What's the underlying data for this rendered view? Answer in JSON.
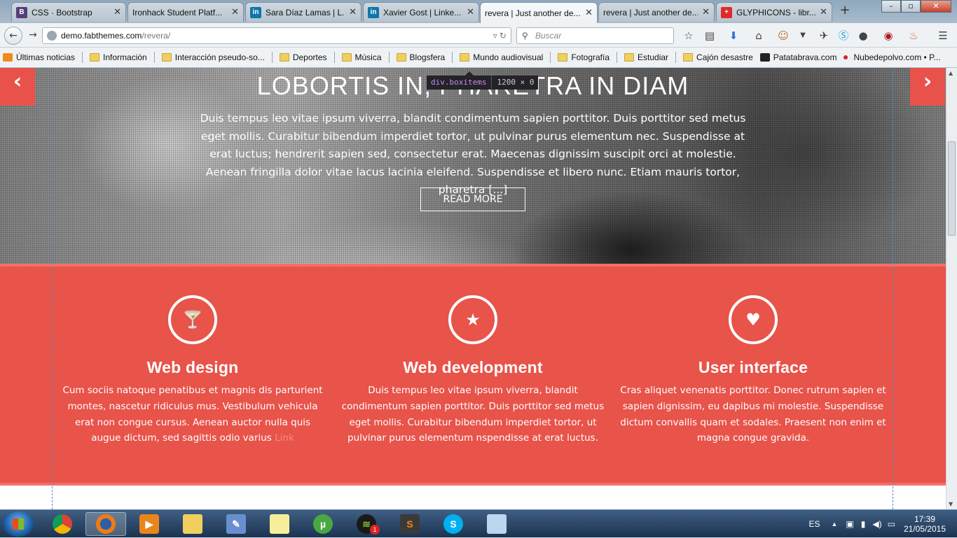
{
  "browser": {
    "tabs": [
      {
        "title": "CSS · Bootstrap",
        "favicon": "B",
        "favicon_color": "#563d7c"
      },
      {
        "title": "Ironhack Student Platf...",
        "favicon": "",
        "favicon_color": ""
      },
      {
        "title": "Sara Díaz Lamas | L...",
        "favicon": "in",
        "favicon_color": "#0e76a8"
      },
      {
        "title": "Xavier Gost | Linke...",
        "favicon": "in",
        "favicon_color": "#0e76a8"
      },
      {
        "title": "revera | Just another de...",
        "favicon": "",
        "favicon_color": ""
      },
      {
        "title": "revera | Just another de...",
        "favicon": "",
        "favicon_color": ""
      },
      {
        "title": "GLYPHICONS - libr...",
        "favicon": "+",
        "favicon_color": "#e02a2a"
      }
    ],
    "url_host": "demo.fabthemes.com",
    "url_path": "/revera/",
    "search_placeholder": "Buscar"
  },
  "bookmarks": [
    {
      "label": "Últimas noticias",
      "icon": "rss-icon"
    },
    {
      "label": "Información",
      "icon": "folder-icon"
    },
    {
      "label": "Interacción pseudo-so...",
      "icon": "folder-icon"
    },
    {
      "label": "Deportes",
      "icon": "folder-icon"
    },
    {
      "label": "Música",
      "icon": "folder-icon"
    },
    {
      "label": "Blogsfera",
      "icon": "folder-icon"
    },
    {
      "label": "Mundo audiovisual",
      "icon": "folder-icon"
    },
    {
      "label": "Fotografía",
      "icon": "folder-icon"
    },
    {
      "label": "Estudiar",
      "icon": "folder-icon"
    },
    {
      "label": "Cajón desastre",
      "icon": "folder-icon"
    },
    {
      "label": "Patatabrava.com",
      "icon": "site-icon"
    },
    {
      "label": "Nubedepolvo.com • P...",
      "icon": "dot-icon"
    }
  ],
  "hero": {
    "title_line": "LOBORTIS IN, PHARETRA IN DIAM",
    "text": "Duis tempus leo vitae ipsum viverra, blandit condimentum sapien porttitor. Duis porttitor sed metus eget mollis. Curabitur bibendum imperdiet tortor, ut pulvinar purus elementum nec. Suspendisse at erat luctus; hendrerit sapien sed, consectetur erat. Maecenas dignissim suscipit orci at molestie. Aenean fringilla dolor vitae lacus lacinia eleifend. Suspendisse et libero nunc. Etiam mauris tortor, pharetra [...]",
    "read_more": "READ MORE",
    "prev_arrow": "‹",
    "next_arrow": "›"
  },
  "inspector": {
    "tag": "div.boxitems",
    "dims": "1200 × 0"
  },
  "services": [
    {
      "icon": "glass-icon",
      "glyph": "🍸",
      "title": "Web design",
      "text": "Cum sociis natoque penatibus et magnis dis parturient montes, nascetur ridiculus mus. Vestibulum vehicula erat non congue cursus. Aenean auctor nulla quis augue dictum, sed sagittis odio varius",
      "link": "Link"
    },
    {
      "icon": "star-icon",
      "glyph": "★",
      "title": "Web development",
      "text": "Duis tempus leo vitae ipsum viverra, blandit condimentum sapien porttitor. Duis porttitor sed metus eget mollis. Curabitur bibendum imperdiet tortor, ut pulvinar purus elementum nspendisse at erat luctus.",
      "link": ""
    },
    {
      "icon": "heart-icon",
      "glyph": "♥",
      "title": "User interface",
      "text": "Cras aliquet venenatis porttitor. Donec rutrum sapien et sapien dignissim, eu dapibus mi molestie. Suspendisse dictum convallis quam et sodales. Praesent non enim et magna congue gravida.",
      "link": ""
    }
  ],
  "taskbar": {
    "lang": "ES",
    "time": "17:39",
    "date": "21/05/2015",
    "spotify_badge": "1"
  },
  "colors": {
    "accent": "#e8534a",
    "accent_light": "#f2706a"
  }
}
